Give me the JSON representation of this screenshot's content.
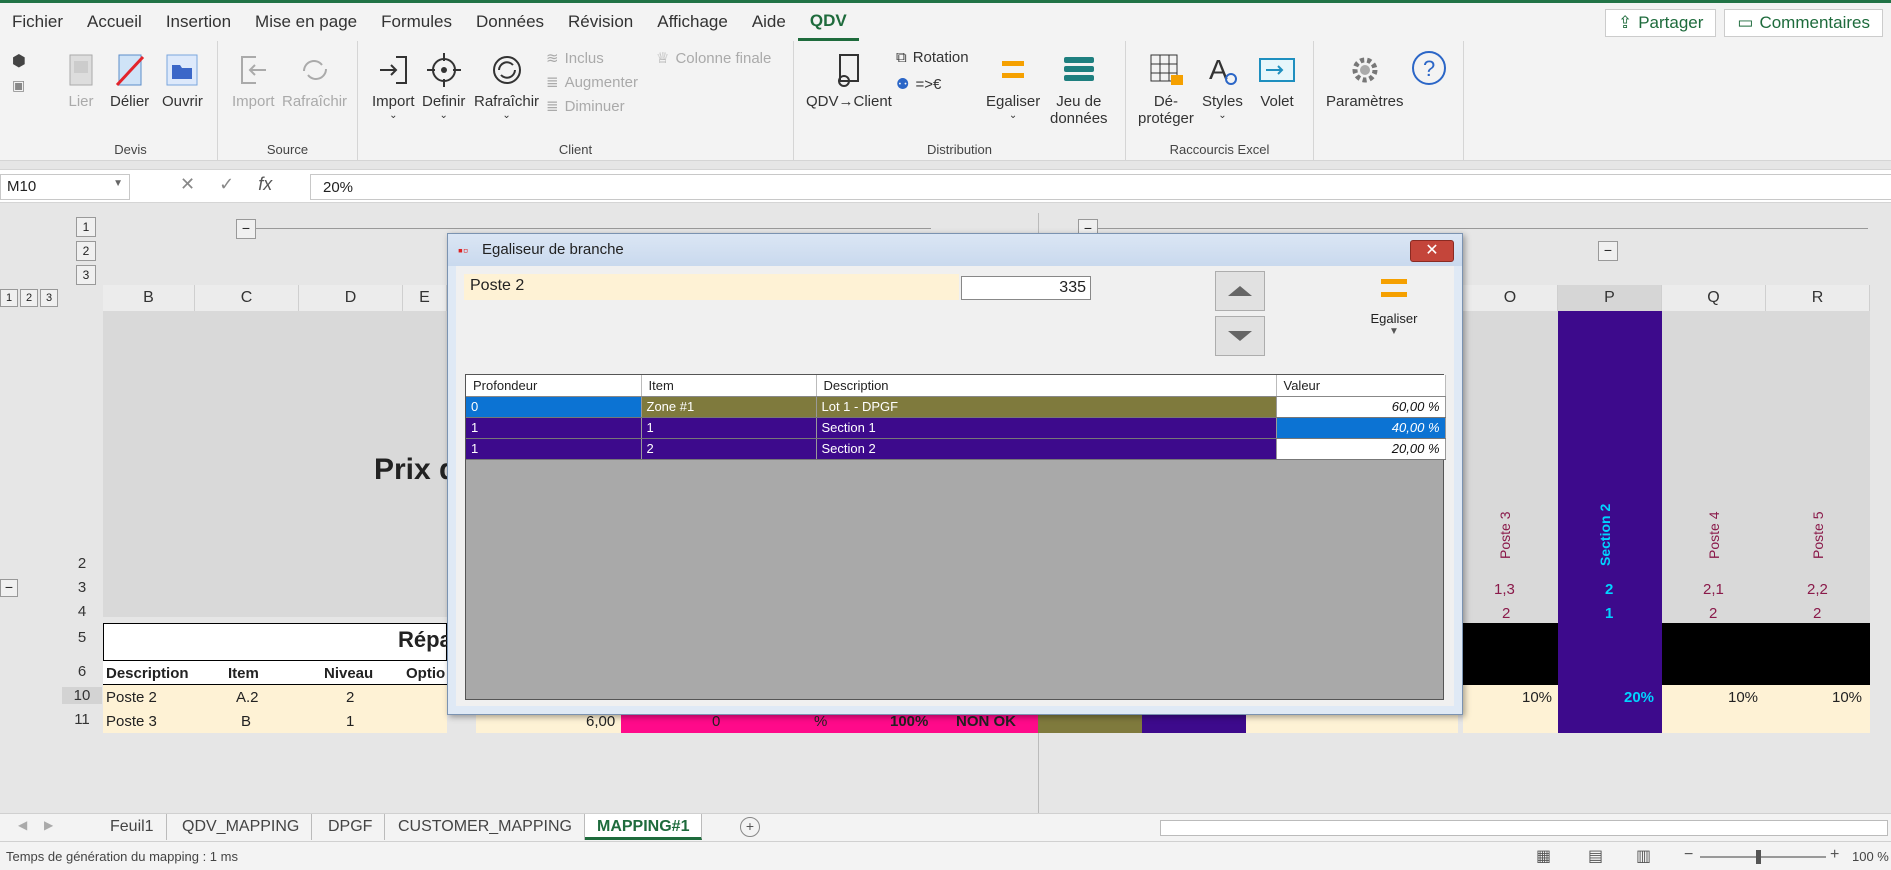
{
  "menu": {
    "items": [
      "Fichier",
      "Accueil",
      "Insertion",
      "Mise en page",
      "Formules",
      "Données",
      "Révision",
      "Affichage",
      "Aide",
      "QDV"
    ],
    "share": "Partager",
    "comments": "Commentaires"
  },
  "ribbon": {
    "devis": {
      "label": "Devis",
      "lier": "Lier",
      "delier": "Délier",
      "ouvrir": "Ouvrir"
    },
    "source": {
      "label": "Source",
      "import": "Import",
      "rafraichir": "Rafraîchir"
    },
    "client": {
      "label": "Client",
      "import": "Import",
      "definir": "Definir",
      "rafraichir": "Rafraîchir",
      "inclus": "Inclus",
      "augmenter": "Augmenter",
      "diminuer": "Diminuer",
      "colonne_finale": "Colonne finale"
    },
    "distribution": {
      "label": "Distribution",
      "qdv_client": "QDV→Client",
      "rotation": "Rotation",
      "euro": "=>€",
      "egaliser": "Egaliser",
      "jeu1": "Jeu de",
      "jeu2": "données"
    },
    "raccourcis": {
      "label": "Raccourcis Excel",
      "deprot1": "Dé-",
      "deprot2": "protéger",
      "styles": "Styles",
      "volet": "Volet"
    },
    "parametres": "Paramètres"
  },
  "formula_bar": {
    "namebox": "M10",
    "value": "20%"
  },
  "sheet": {
    "outline_levels": [
      "1",
      "2",
      "3"
    ],
    "columns_left": [
      "B",
      "C",
      "D",
      "E"
    ],
    "columns_right": [
      "O",
      "P",
      "Q",
      "R"
    ],
    "title_partial": "Prix d",
    "repart_partial": "Répa",
    "rows": [
      "2",
      "3",
      "4",
      "5",
      "6",
      "10",
      "11"
    ],
    "header_row": [
      "Description",
      "Item",
      "Niveau",
      "Optio"
    ],
    "row10": [
      "Poste 2",
      "A.2",
      "2"
    ],
    "row11": [
      "Poste 3",
      "B",
      "1"
    ],
    "row11_extra": [
      "6,00",
      "0",
      "%",
      "100%",
      "NON OK"
    ],
    "right_cols": [
      {
        "name": "Poste 3",
        "r3": "1,3",
        "r4": "2",
        "r10": "10%"
      },
      {
        "name": "Section 2",
        "r3": "2",
        "r4": "1",
        "r10": "20%"
      },
      {
        "name": "Poste 4",
        "r3": "2,1",
        "r4": "2",
        "r10": "10%"
      },
      {
        "name": "Poste 5",
        "r3": "2,2",
        "r4": "2",
        "r10": "10%"
      }
    ]
  },
  "dialog": {
    "title": "Egaliseur de branche",
    "poste_label": "Poste 2",
    "poste_value": "335",
    "egaliser": "Egaliser",
    "headers": [
      "Profondeur",
      "Item",
      "Description",
      "Valeur"
    ],
    "rows": [
      {
        "profondeur": "0",
        "item": "Zone #1",
        "description": "Lot 1 - DPGF",
        "valeur": "60,00 %"
      },
      {
        "profondeur": "1",
        "item": "1",
        "description": "Section 1",
        "valeur": "40,00 %"
      },
      {
        "profondeur": "1",
        "item": "2",
        "description": "Section 2",
        "valeur": "20,00 %"
      }
    ]
  },
  "tabs": [
    "Feuil1",
    "QDV_MAPPING",
    "DPGF",
    "CUSTOMER_MAPPING",
    "MAPPING#1"
  ],
  "status": {
    "text": "Temps de génération du mapping : 1 ms",
    "zoom": "100 %"
  },
  "colors": {
    "olive": "#7f7a3d",
    "purple": "#3d0a8c",
    "blue": "#0c73d3",
    "pink": "#ff0a8a",
    "cream": "#fef2d5"
  }
}
